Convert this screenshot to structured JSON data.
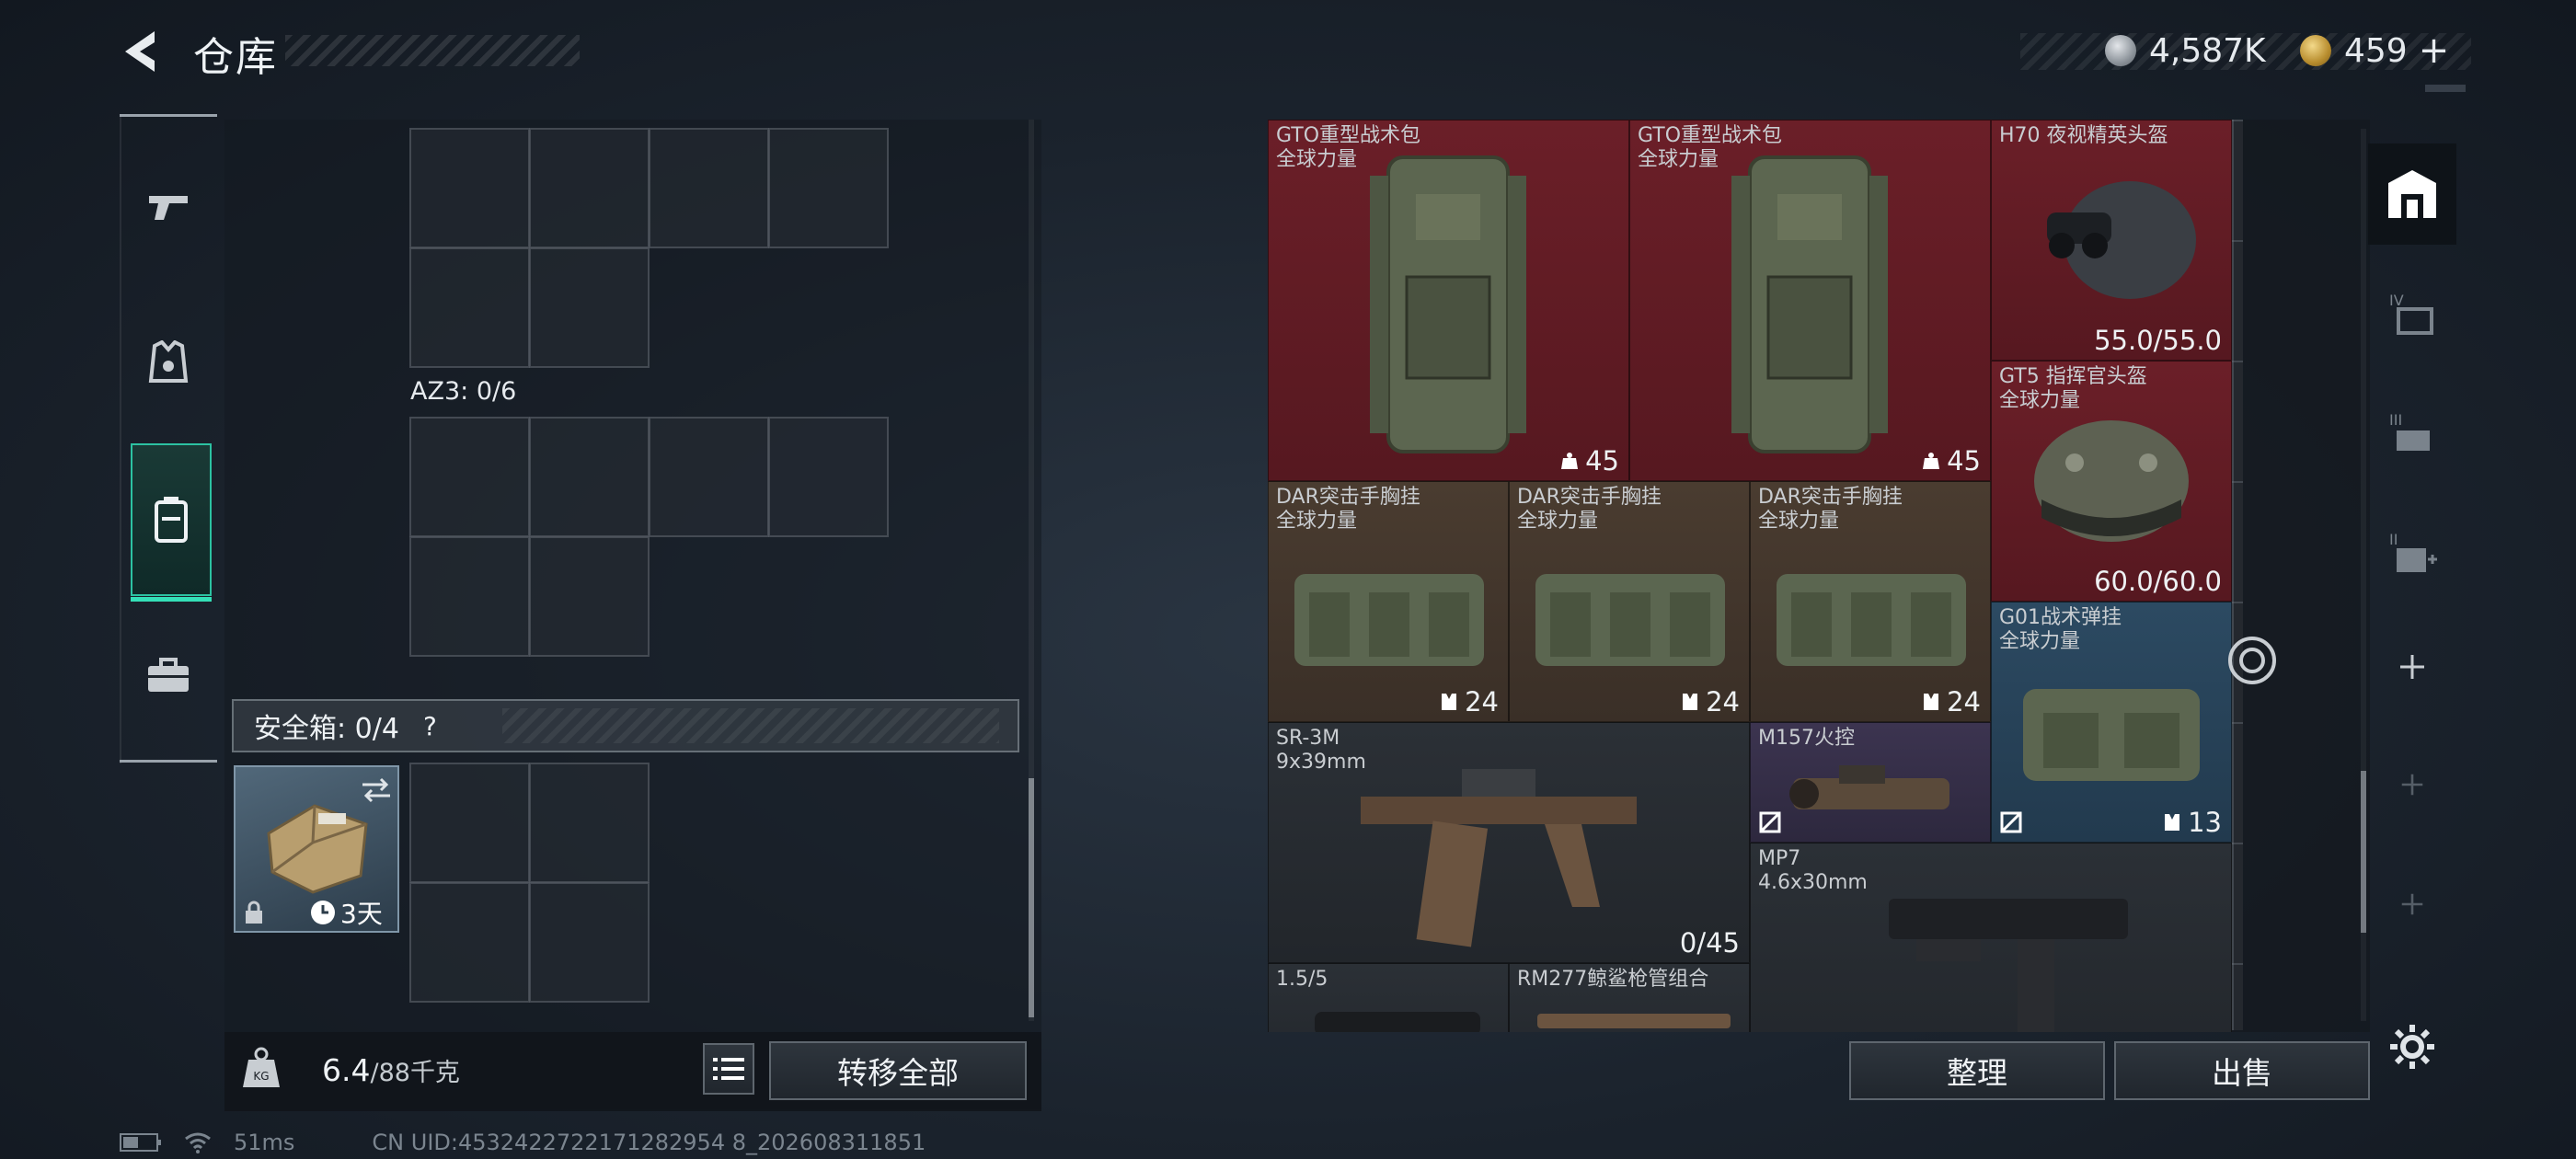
{
  "header": {
    "title": "仓库"
  },
  "currency": {
    "silver": "4,587K",
    "gold": "459",
    "gold_plus": "+"
  },
  "left": {
    "container_label": "AZ3: 0/6",
    "safe_box": {
      "label": "安全箱: 0/4",
      "help": "?",
      "duration": "3天"
    },
    "weight": {
      "current": "6.4",
      "max": "/88千克"
    },
    "transfer_all": "转移全部"
  },
  "stash": {
    "items": [
      {
        "name": "GTO重型战术包",
        "sub": "全球力量",
        "count": "45"
      },
      {
        "name": "GTO重型战术包",
        "sub": "全球力量",
        "count": "45"
      },
      {
        "name": "H70 夜视精英头盔",
        "sub": "",
        "count": "55.0/55.0"
      },
      {
        "name": "GT5 指挥官头盔",
        "sub": "全球力量",
        "count": "60.0/60.0"
      },
      {
        "name": "DAR突击手胸挂",
        "sub": "全球力量",
        "count": "24"
      },
      {
        "name": "DAR突击手胸挂",
        "sub": "全球力量",
        "count": "24"
      },
      {
        "name": "DAR突击手胸挂",
        "sub": "全球力量",
        "count": "24"
      },
      {
        "name": "G01战术弹挂",
        "sub": "全球力量",
        "count": "13"
      },
      {
        "name": "SR-3M",
        "sub": "9x39mm",
        "count": "0/45"
      },
      {
        "name": "M157火控",
        "sub": "",
        "count": ""
      },
      {
        "name": "MP7",
        "sub": "4.6x30mm",
        "count": ""
      },
      {
        "name": "1.5/5",
        "sub": "",
        "count": ""
      },
      {
        "name": "RM277鲸鲨枪管组合",
        "sub": "",
        "count": ""
      }
    ],
    "sort_button": "整理",
    "sell_button": "出售"
  },
  "status": {
    "ping": "51ms",
    "uid": "CN UID:4532422722171282954 8_202608311851"
  }
}
